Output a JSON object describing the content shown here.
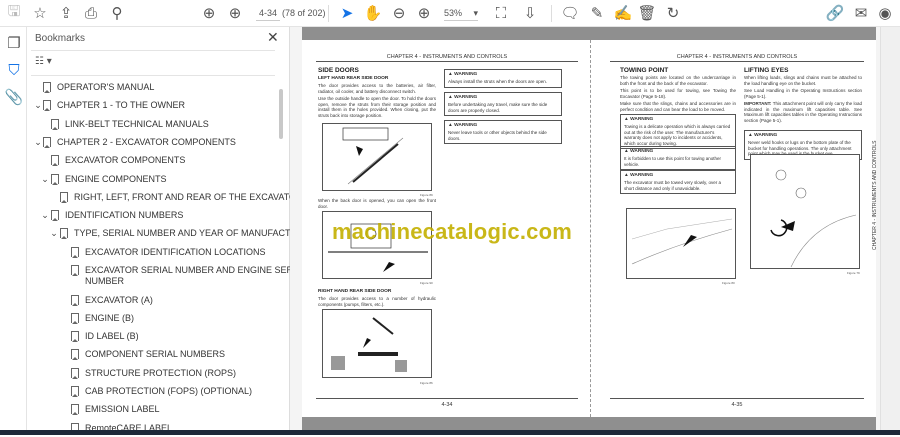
{
  "toolbar": {
    "left_icons": [
      "save-icon",
      "star-icon",
      "cloud-upload-icon",
      "print-icon",
      "search-zoom-icon"
    ],
    "page_current": "4-34",
    "page_count": "(78 of 202)",
    "zoom_level": "53%",
    "right_icons": [
      "comment-icon",
      "highlight-pen-icon",
      "draw-icon",
      "trash-icon",
      "rotate-icon",
      "link-share-icon",
      "mail-icon",
      "account-icon"
    ]
  },
  "bookmarks": {
    "title": "Bookmarks",
    "items": [
      {
        "label": "OPERATOR'S MANUAL",
        "level": 0,
        "expand": "none"
      },
      {
        "label": "CHAPTER 1 - TO THE OWNER",
        "level": 0,
        "expand": "open"
      },
      {
        "label": "LINK-BELT TECHNICAL MANUALS",
        "level": 1,
        "expand": "none"
      },
      {
        "label": "CHAPTER 2 - EXCAVATOR COMPONENTS",
        "level": 0,
        "expand": "open"
      },
      {
        "label": "EXCAVATOR COMPONENTS",
        "level": 1,
        "expand": "none"
      },
      {
        "label": "ENGINE COMPONENTS",
        "level": 1,
        "expand": "open"
      },
      {
        "label": "RIGHT, LEFT, FRONT AND REAR OF THE EXCAVATOR",
        "level": 2,
        "expand": "none"
      },
      {
        "label": "IDENTIFICATION NUMBERS",
        "level": 1,
        "expand": "open"
      },
      {
        "label": "TYPE, SERIAL NUMBER AND YEAR OF MANUFACTURE",
        "level": 2,
        "expand": "open"
      },
      {
        "label": "EXCAVATOR IDENTIFICATION LOCATIONS",
        "level": 3,
        "expand": "none"
      },
      {
        "label": "EXCAVATOR SERIAL NUMBER AND ENGINE SERIAL",
        "label2": "NUMBER",
        "level": 3,
        "expand": "none"
      },
      {
        "label": "EXCAVATOR (A)",
        "level": 3,
        "expand": "none"
      },
      {
        "label": "ENGINE (B)",
        "level": 3,
        "expand": "none"
      },
      {
        "label": "ID LABEL (B)",
        "level": 3,
        "expand": "none"
      },
      {
        "label": "COMPONENT SERIAL NUMBERS",
        "level": 3,
        "expand": "none"
      },
      {
        "label": "STRUCTURE PROTECTION (ROPS)",
        "level": 3,
        "expand": "none"
      },
      {
        "label": "CAB PROTECTION (FOPS) (OPTIONAL)",
        "level": 3,
        "expand": "none"
      },
      {
        "label": "EMISSION LABEL",
        "level": 3,
        "expand": "none"
      },
      {
        "label": "RemoteCARE LABEL",
        "level": 3,
        "expand": "none"
      }
    ]
  },
  "document": {
    "watermark": "machinecatalogic.com",
    "left_page": {
      "header": "CHAPTER 4 - INSTRUMENTS AND CONTROLS",
      "title": "SIDE DOORS",
      "sub1": "LEFT HAND REAR SIDE DOOR",
      "p1": "The door provides access to the batteries, air filter, radiator, oil cooler, and battery disconnect switch.",
      "p2": "Use the outside handle to open the door. To hold the doors open, remove the struts from their storage position and install them in the holes provided. When closing, put the struts back into storage position.",
      "fig1_caption": "Figure 89",
      "p3": "When the back door is opened, you can open the front door.",
      "fig2_caption": "Figure 90",
      "sub2": "RIGHT HAND REAR SIDE DOOR",
      "p4": "The door provides access to a number of hydraulic components (pumps, filters, etc.).",
      "fig3_caption": "Figure 86",
      "warnings": [
        {
          "title": "WARNING",
          "text": "Always install the struts when the doors are open."
        },
        {
          "title": "WARNING",
          "text": "Before undertaking any travel, make sure the side doors are properly closed."
        },
        {
          "title": "WARNING",
          "text": "Never leave tools or other objects behind the side doors."
        }
      ],
      "footer": "4-34"
    },
    "right_page": {
      "header": "CHAPTER 4 - INSTRUMENTS AND CONTROLS",
      "title1": "TOWING POINT",
      "p1": "The towing points are located on the undercarriage in both the front and the back of the excavator.",
      "p2": "This point is to be used for towing, see Towing the Excavator (Page 5-18).",
      "p3": "Make sure that the slings, chains and accessories are in perfect condition and can bear the load to be moved.",
      "warnings1": [
        {
          "title": "WARNING",
          "text": "Towing is a delicate operation which is always carried out at the risk of the user. The manufacturer's warranty does not apply to incidents or accidents, which occur during towing."
        },
        {
          "title": "WARNING",
          "text": "It is forbidden to use this point for towing another vehicle."
        },
        {
          "title": "WARNING",
          "text": "The excavator must be towed very slowly, over a short distance and only if unavoidable."
        }
      ],
      "fig1_caption": "Figure 80",
      "title2": "LIFTING EYES",
      "q1": "When lifting loads, slings and chains must be attached to the load handling eye on the bucket.",
      "q2": "See Load Handling in the Operating Instructions section (Page 5-1).",
      "q3_bold": "IMPORTANT:",
      "q3": " This attachment point will only carry the load indicated in the maximum lift capacities table. See Maximum lift capacities tables in the Operating Instructions section (Page 5-1).",
      "warning2": {
        "title": "WARNING",
        "text": "Never weld hooks or lugs on the bottom plate of the bucket for handling operations. The only attachment point which may be used is the bucket eye."
      },
      "fig2_caption": "Figure 79",
      "side_tab": "CHAPTER 4 - INSTRUMENTS AND CONTROLS",
      "footer": "4-35"
    }
  }
}
